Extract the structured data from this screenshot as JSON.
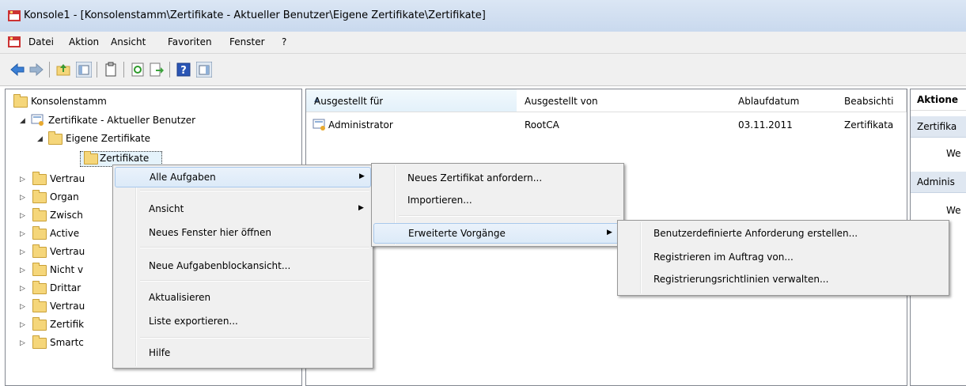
{
  "window": {
    "title": "Konsole1 - [Konsolenstamm\\Zertifikate - Aktueller Benutzer\\Eigene Zertifikate\\Zertifikate]"
  },
  "menubar": {
    "items": [
      "Datei",
      "Aktion",
      "Ansicht",
      "Favoriten",
      "Fenster",
      "?"
    ]
  },
  "toolbar": {
    "buttons": [
      "back-arrow-icon",
      "forward-arrow-icon",
      "up-folder-icon",
      "show-hide-tree-icon",
      "properties-icon",
      "refresh-icon",
      "export-list-icon",
      "help-icon",
      "show-hide-action-pane-icon"
    ]
  },
  "tree": {
    "root": "Konsolenstamm",
    "store": "Zertifikate - Aktueller Benutzer",
    "own_certs": "Eigene Zertifikate",
    "selected": "Zertifikate",
    "folders": [
      "Vertrau",
      "Organ",
      "Zwisch",
      "Active",
      "Vertrau",
      "Nicht v",
      "Drittar",
      "Vertrau",
      "Zertifik",
      "Smartc"
    ]
  },
  "list": {
    "columns": [
      "Ausgestellt für",
      "Ausgestellt von",
      "Ablaufdatum",
      "Beabsichti"
    ],
    "rows": [
      {
        "issued_to": "Administrator",
        "issued_by": "RootCA",
        "expires": "03.11.2011",
        "purpose": "Zertifikata"
      }
    ]
  },
  "actions": {
    "header": "Aktione",
    "sections": [
      {
        "title": "Zertifika",
        "item": "We"
      },
      {
        "title": "Adminis",
        "item": "We"
      }
    ]
  },
  "context_menu": {
    "items": [
      {
        "label": "Alle Aufgaben",
        "submenu": true
      },
      {
        "label": "Ansicht",
        "submenu": true
      },
      {
        "label": "Neues Fenster hier öffnen"
      },
      {
        "label": "Neue Aufgabenblockansicht..."
      },
      {
        "label": "Aktualisieren"
      },
      {
        "label": "Liste exportieren..."
      },
      {
        "label": "Hilfe"
      }
    ]
  },
  "submenu_all_tasks": {
    "items": [
      {
        "label": "Neues Zertifikat anfordern..."
      },
      {
        "label": "Importieren..."
      },
      {
        "label": "Erweiterte Vorgänge",
        "submenu": true
      }
    ]
  },
  "submenu_advanced": {
    "items": [
      {
        "label": "Benutzerdefinierte Anforderung erstellen..."
      },
      {
        "label": "Registrieren im Auftrag von..."
      },
      {
        "label": "Registrierungsrichtlinien verwalten..."
      }
    ]
  },
  "colors": {
    "selection": "#dceaf8",
    "menu_bg": "#f0f0f0",
    "title_bg": "#c9d9ee",
    "folder": "#f5d67a"
  }
}
